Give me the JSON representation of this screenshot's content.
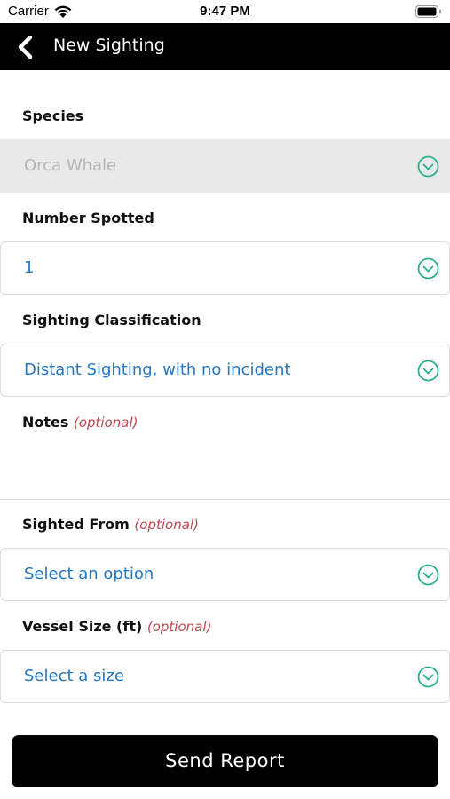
{
  "status_bar": {
    "carrier": "Carrier",
    "time": "9:47 PM",
    "wifi_icon": "wifi-icon",
    "battery_icon": "battery-icon"
  },
  "nav": {
    "title": "New Sighting",
    "back_icon": "chevron-left-icon"
  },
  "form": {
    "species": {
      "label": "Species",
      "value": "Orca Whale",
      "disabled": true
    },
    "number_spotted": {
      "label": "Number Spotted",
      "value": "1"
    },
    "classification": {
      "label": "Sighting Classification",
      "value": "Distant Sighting, with no incident"
    },
    "notes": {
      "label": "Notes",
      "optional": "(optional)",
      "value": ""
    },
    "sighted_from": {
      "label": "Sighted From",
      "optional": "(optional)",
      "value": "Select an option"
    },
    "vessel_size": {
      "label": "Vessel Size (ft)",
      "optional": "(optional)",
      "value": "Select a size"
    }
  },
  "actions": {
    "send_label": "Send Report"
  },
  "colors": {
    "accent_teal": "#2bae8c",
    "value_blue": "#2577c2",
    "optional_red": "#c0474f",
    "nav_background": "#000000"
  }
}
